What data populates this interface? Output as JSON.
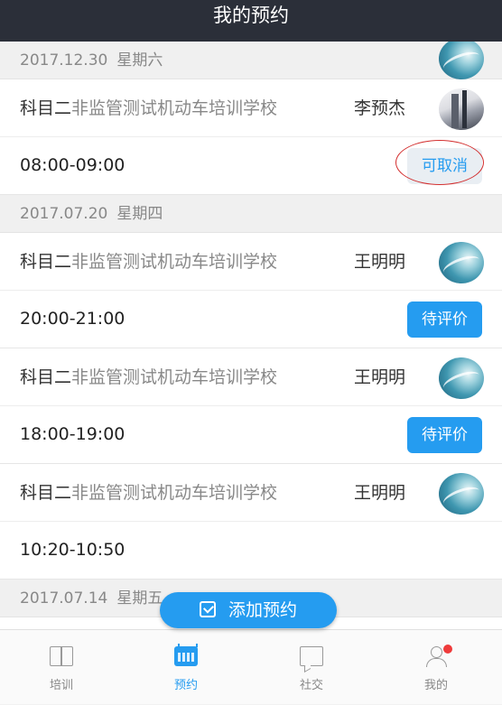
{
  "header": {
    "title": "我的预约"
  },
  "groups": [
    {
      "date": "2017.12.30",
      "weekday": "星期六",
      "items": [
        {
          "subject_prefix": "科目二",
          "school": "非监管测试机动车培训学校",
          "coach": "李预杰",
          "avatar": "building-avatar",
          "time": "08:00-09:00",
          "action": "可取消"
        }
      ]
    },
    {
      "date": "2017.07.20",
      "weekday": "星期四",
      "items": [
        {
          "subject_prefix": "科目二",
          "school": "非监管测试机动车培训学校",
          "coach": "王明明",
          "avatar": "wave-avatar",
          "time": "20:00-21:00",
          "action": "待评价"
        },
        {
          "subject_prefix": "科目二",
          "school": "非监管测试机动车培训学校",
          "coach": "王明明",
          "avatar": "wave-avatar",
          "time": "18:00-19:00",
          "action": "待评价"
        },
        {
          "subject_prefix": "科目二",
          "school": "非监管测试机动车培训学校",
          "coach": "王明明",
          "avatar": "wave-avatar",
          "time": "10:20-10:50",
          "action": ""
        }
      ]
    },
    {
      "date": "2017.07.14",
      "weekday": "星期五",
      "items": []
    }
  ],
  "fab": {
    "label": "添加预约",
    "icon": "calendar-check-icon"
  },
  "tabs": [
    {
      "label": "培训",
      "icon": "book-icon"
    },
    {
      "label": "预约",
      "icon": "calendar-icon"
    },
    {
      "label": "社交",
      "icon": "chat-icon"
    },
    {
      "label": "我的",
      "icon": "person-icon"
    }
  ],
  "colors": {
    "accent": "#259cf0",
    "header_bg": "#2b2f39",
    "badge": "#ef3b3b",
    "annotation": "#d32f2f"
  }
}
